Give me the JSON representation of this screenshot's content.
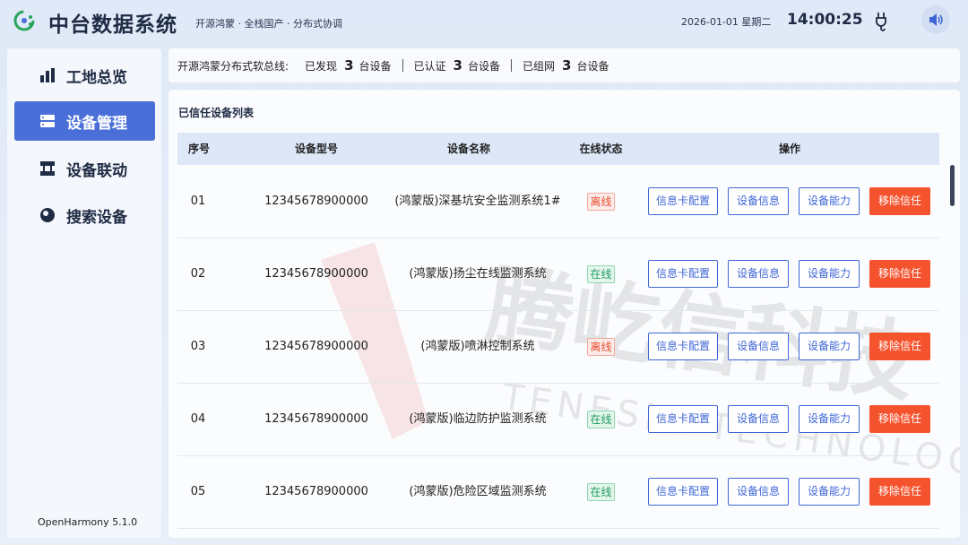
{
  "header": {
    "logo_icon": "system-logo-icon",
    "title": "中台数据系统",
    "subtitle": "开源鸿蒙 · 全栈国产 · 分布式协调",
    "date": "2026-01-01 星期二",
    "time": "14:00:25",
    "plug_icon": "usb-plug-icon",
    "sound_icon": "speaker-icon"
  },
  "sidebar": {
    "items": [
      {
        "label": "工地总览",
        "icon": "bar-chart-icon",
        "active": false
      },
      {
        "label": "设备管理",
        "icon": "device-list-icon",
        "active": true
      },
      {
        "label": "设备联动",
        "icon": "linkage-icon",
        "active": false
      },
      {
        "label": "搜索设备",
        "icon": "search-icon",
        "active": false
      }
    ],
    "version": "OpenHarmony 5.1.0"
  },
  "discover": {
    "prefix": "开源鸿蒙分布式软总线:",
    "found_label": "已发现",
    "found_count": "3",
    "authed_label": "已认证",
    "authed_count": "3",
    "networked_label": "已组网",
    "networked_count": "3",
    "unit": "台设备"
  },
  "table": {
    "title": "已信任设备列表",
    "columns": [
      "序号",
      "设备型号",
      "设备名称",
      "在线状态",
      "操作"
    ],
    "actions": [
      "信息卡配置",
      "设备信息",
      "设备能力",
      "移除信任"
    ],
    "rows": [
      {
        "no": "01",
        "model": "12345678900000",
        "name": "(鸿蒙版)深基坑安全监测系统1#",
        "status": "离线",
        "online": false
      },
      {
        "no": "02",
        "model": "12345678900000",
        "name": "(鸿蒙版)扬尘在线监测系统",
        "status": "在线",
        "online": true
      },
      {
        "no": "03",
        "model": "12345678900000",
        "name": "(鸿蒙版)喷淋控制系统",
        "status": "离线",
        "online": false
      },
      {
        "no": "04",
        "model": "12345678900000",
        "name": "(鸿蒙版)临边防护监测系统",
        "status": "在线",
        "online": true
      },
      {
        "no": "05",
        "model": "12345678900000",
        "name": "(鸿蒙版)危险区域监测系统",
        "status": "在线",
        "online": true
      }
    ]
  },
  "watermark": {
    "cn": "腾屹信科技",
    "en": "TENESIN TECHNOLOGY"
  },
  "colors": {
    "accent": "#4a6fd8",
    "danger": "#f4532e",
    "online": "#1f9a62",
    "offline": "#e64a2e"
  }
}
